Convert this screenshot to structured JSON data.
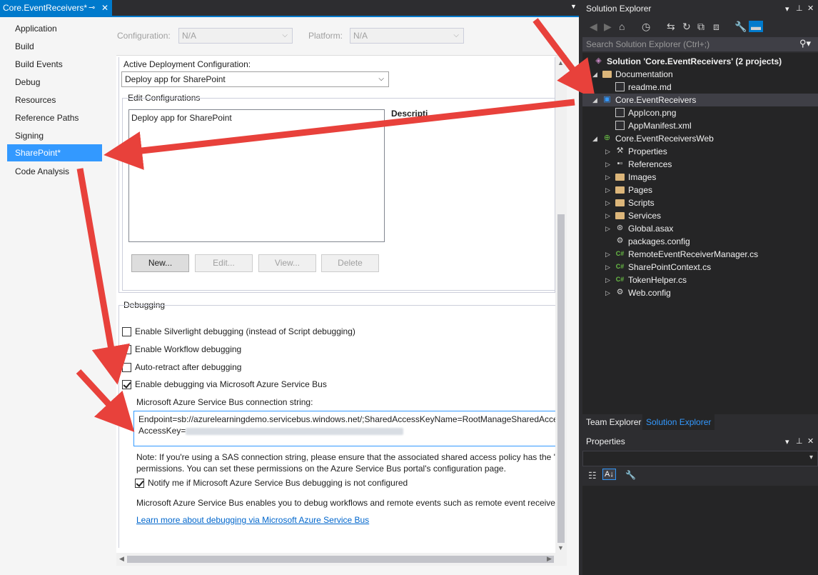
{
  "doc_tab": {
    "title": "Core.EventReceivers*",
    "pin": "⊸",
    "close": "✕"
  },
  "nav": {
    "items": [
      "Application",
      "Build",
      "Build Events",
      "Debug",
      "Resources",
      "Reference Paths",
      "Signing",
      "SharePoint*",
      "Code Analysis"
    ],
    "active": "SharePoint*"
  },
  "config": {
    "config_label": "Configuration:",
    "config_value": "N/A",
    "platform_label": "Platform:",
    "platform_value": "N/A"
  },
  "deployment": {
    "active_label": "Active Deployment Configuration:",
    "active_value": "Deploy app for SharePoint",
    "edit_label": "Edit Configurations",
    "list_items": [
      "Deploy app for SharePoint"
    ],
    "description_label": "Descripti",
    "buttons": {
      "new": "New...",
      "edit": "Edit...",
      "view": "View...",
      "delete": "Delete"
    }
  },
  "debugging": {
    "header": "Debugging",
    "silverlight": "Enable Silverlight debugging (instead of Script debugging)",
    "workflow": "Enable Workflow debugging",
    "autoretract": "Auto-retract after debugging",
    "servicebus": "Enable debugging via Microsoft Azure Service Bus",
    "conn_label": "Microsoft Azure Service Bus connection string:",
    "conn_line1": "Endpoint=sb://azurelearningdemo.servicebus.windows.net/;SharedAccessKeyName=RootManageSharedAcces",
    "conn_line2": "AccessKey=",
    "note_line1": "Note: If you're using a SAS connection string, please ensure that the associated shared access policy has the 'Ma",
    "note_line2": "permissions. You can set these permissions on the Azure Service Bus portal's configuration page.",
    "notify": "Notify me if Microsoft Azure Service Bus debugging is not configured",
    "info": "Microsoft Azure Service Bus enables you to debug workflows and remote events such as remote event receivers",
    "learn_more": "Learn more about debugging via Microsoft Azure Service Bus",
    "checked": {
      "silverlight": false,
      "workflow": false,
      "autoretract": false,
      "servicebus": true,
      "notify": true
    }
  },
  "solution_explorer": {
    "title": "Solution Explorer",
    "search_placeholder": "Search Solution Explorer (Ctrl+;)",
    "tree": [
      {
        "label": "Solution 'Core.EventReceivers' (2 projects)",
        "level": 0,
        "icon": "solution-icon",
        "expander": ""
      },
      {
        "label": "Documentation",
        "level": 1,
        "icon": "folder-icon",
        "expander": "◢"
      },
      {
        "label": "readme.md",
        "level": 2,
        "icon": "file-icon",
        "expander": ""
      },
      {
        "label": "Core.EventReceivers",
        "level": 1,
        "icon": "sharepoint-project-icon",
        "expander": "◢",
        "selected": true
      },
      {
        "label": "AppIcon.png",
        "level": 2,
        "icon": "image-file-icon",
        "expander": ""
      },
      {
        "label": "AppManifest.xml",
        "level": 2,
        "icon": "xml-file-icon",
        "expander": ""
      },
      {
        "label": "Core.EventReceiversWeb",
        "level": 1,
        "icon": "web-project-icon",
        "expander": "◢"
      },
      {
        "label": "Properties",
        "level": 2,
        "icon": "wrench-icon",
        "expander": "▷"
      },
      {
        "label": "References",
        "level": 2,
        "icon": "references-icon",
        "expander": "▷"
      },
      {
        "label": "Images",
        "level": 2,
        "icon": "folder-icon",
        "expander": "▷"
      },
      {
        "label": "Pages",
        "level": 2,
        "icon": "folder-icon",
        "expander": "▷"
      },
      {
        "label": "Scripts",
        "level": 2,
        "icon": "folder-icon",
        "expander": "▷"
      },
      {
        "label": "Services",
        "level": 2,
        "icon": "folder-icon",
        "expander": "▷"
      },
      {
        "label": "Global.asax",
        "level": 2,
        "icon": "global-asax-icon",
        "expander": "▷"
      },
      {
        "label": "packages.config",
        "level": 2,
        "icon": "config-file-icon",
        "expander": ""
      },
      {
        "label": "RemoteEventReceiverManager.cs",
        "level": 2,
        "icon": "csharp-file-icon",
        "expander": "▷"
      },
      {
        "label": "SharePointContext.cs",
        "level": 2,
        "icon": "csharp-file-icon",
        "expander": "▷"
      },
      {
        "label": "TokenHelper.cs",
        "level": 2,
        "icon": "csharp-file-icon",
        "expander": "▷"
      },
      {
        "label": "Web.config",
        "level": 2,
        "icon": "config-file-icon",
        "expander": "▷"
      }
    ]
  },
  "bottom_tabs": {
    "team": "Team Explorer",
    "solution": "Solution Explorer"
  },
  "properties": {
    "title": "Properties"
  },
  "colors": {
    "accent": "#007acc",
    "selection": "#3399ff",
    "arrow": "#e8413b"
  }
}
